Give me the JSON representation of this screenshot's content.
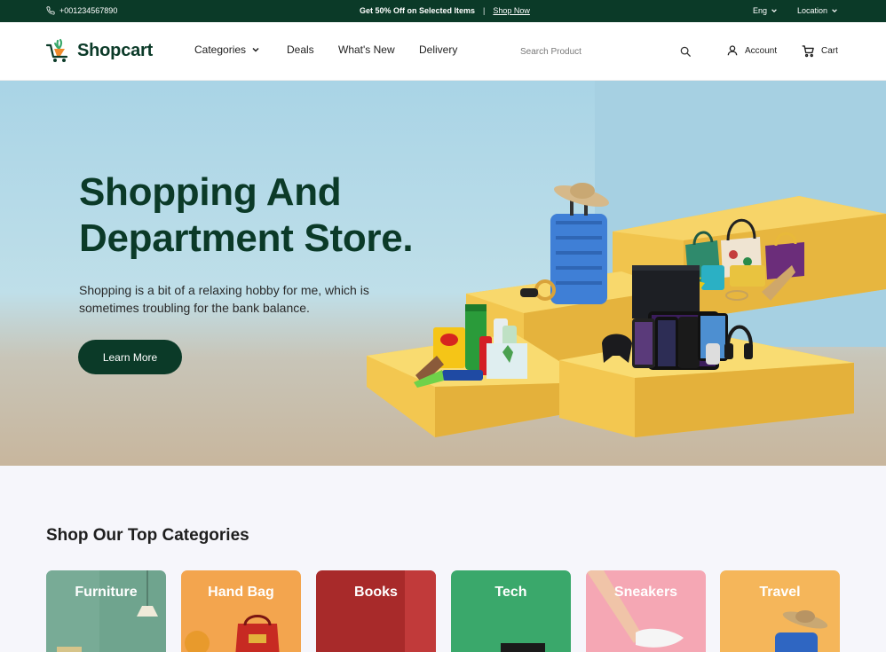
{
  "topbar": {
    "phone": "+001234567890",
    "promo": "Get 50% Off on Selected Items",
    "promo_sep": "|",
    "promo_link": "Shop Now",
    "language": "Eng",
    "location": "Location"
  },
  "header": {
    "logo": "Shopcart",
    "nav": {
      "categories": "Categories",
      "deals": "Deals",
      "whats_new": "What's New",
      "delivery": "Delivery"
    },
    "search": {
      "placeholder": "Search Product",
      "value": ""
    },
    "account": "Account",
    "cart": "Cart"
  },
  "hero": {
    "title": "Shopping And\nDepartment Store.",
    "subtitle": "Shopping is a bit of a relaxing hobby for me, which is sometimes troubling for the bank balance.",
    "button": "Learn More"
  },
  "categories": {
    "title": "Shop Our Top Categories",
    "items": [
      {
        "label": "Furniture",
        "color": "#6fa48e"
      },
      {
        "label": "Hand Bag",
        "color": "#f3a54e"
      },
      {
        "label": "Books",
        "color": "#a82a2a"
      },
      {
        "label": "Tech",
        "color": "#3aa86b"
      },
      {
        "label": "Sneakers",
        "color": "#f5a7b4"
      },
      {
        "label": "Travel",
        "color": "#f5b65a"
      }
    ]
  },
  "colors": {
    "brand": "#0b3a28",
    "accent": "#f5c448"
  },
  "icons": [
    "phone-icon",
    "chevron-down-icon",
    "logo-cart-icon",
    "search-icon",
    "user-icon",
    "cart-icon"
  ]
}
